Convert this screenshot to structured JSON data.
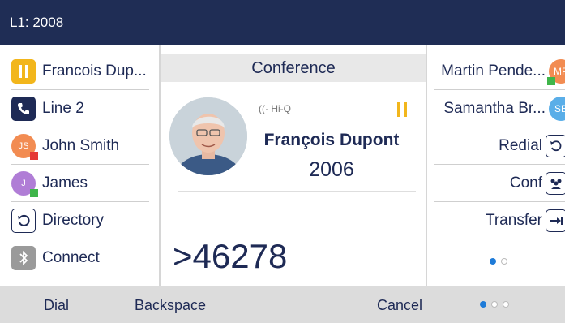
{
  "header": {
    "title": "L1: 2008"
  },
  "left_keys": [
    {
      "label": "Francois Dup...",
      "icon": "pause-icon"
    },
    {
      "label": "Line 2",
      "icon": "phone-handset-icon"
    },
    {
      "label": "John Smith",
      "avatar_initials": "JS",
      "avatar_color": "#f28c52",
      "presence_color": "#e53935"
    },
    {
      "label": "James",
      "avatar_initials": "J",
      "avatar_color": "#b07dd6",
      "presence_color": "#3fb54a"
    },
    {
      "label": "Directory",
      "icon": "directory-icon"
    },
    {
      "label": "Connect",
      "icon": "bluetooth-icon"
    }
  ],
  "center": {
    "conference_label": "Conference",
    "hiq_label": "Hi-Q",
    "caller_name": "François Dupont",
    "caller_number": "2006",
    "dialed_digits": ">46278"
  },
  "right_keys": [
    {
      "label": "Martin Pende...",
      "avatar_initials": "MP",
      "avatar_color": "#f28c52",
      "presence_color": "#3fb54a"
    },
    {
      "label": "Samantha Br...",
      "avatar_initials": "SB",
      "avatar_color": "#5aaee8"
    },
    {
      "label": "Redial",
      "icon": "redial-icon"
    },
    {
      "label": "Conf",
      "icon": "conference-icon"
    },
    {
      "label": "Transfer",
      "icon": "transfer-icon"
    }
  ],
  "pagination": {
    "right_panel": {
      "pages": 2,
      "current": 1
    },
    "softkeys": {
      "pages": 3,
      "current": 1
    }
  },
  "softkeys": {
    "dial": "Dial",
    "backspace": "Backspace",
    "cancel": "Cancel"
  },
  "colors": {
    "header_bg": "#1f2d55",
    "accent_blue": "#1e7bd8",
    "pause_yellow": "#f2b61c",
    "text_navy": "#1e2a55"
  }
}
